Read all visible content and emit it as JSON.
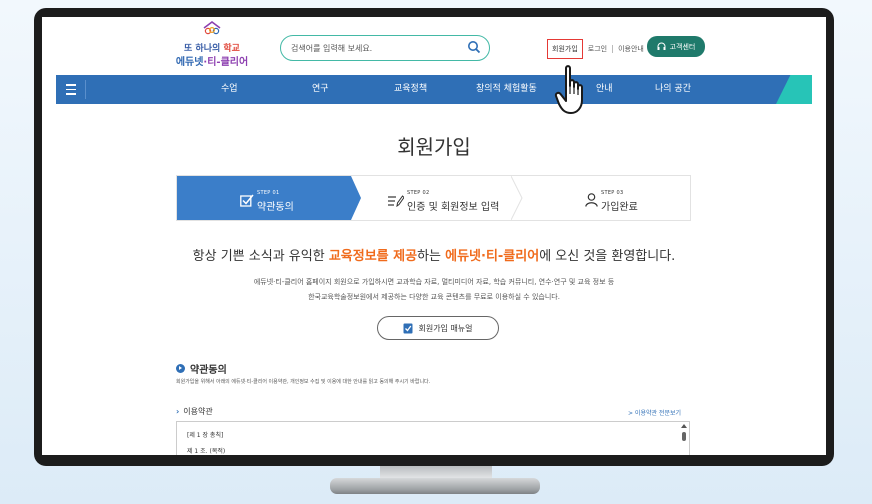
{
  "logo": {
    "line1_a": "또 하나의 ",
    "line1_b": "학교",
    "line2_a": "에듀넷",
    "line2_b": "·티-클리어"
  },
  "search": {
    "placeholder": "검색어를 입력해 보세요."
  },
  "top_links": [
    {
      "label": "회원가입",
      "highlighted": true
    },
    {
      "label": "로그인"
    },
    {
      "label": "이용안내"
    }
  ],
  "customer_center": {
    "label": "고객센터"
  },
  "gnb": {
    "items": [
      "수업",
      "연구",
      "교육정책",
      "창의적 체험활동",
      "안내",
      "나의 공간"
    ]
  },
  "page_title": "회원가입",
  "steps": [
    {
      "step_no": "STEP 01",
      "label": "약관동의",
      "active": true
    },
    {
      "step_no": "STEP 02",
      "label": "인증 및 회원정보 입력",
      "active": false
    },
    {
      "step_no": "STEP 03",
      "label": "가입완료",
      "active": false
    }
  ],
  "welcome": {
    "pre": "항상 기쁜 소식과 유익한 ",
    "highlight1": "교육정보를 제공",
    "mid": "하는 ",
    "highlight2": "에듀넷·티-클리어",
    "post": "에 오신 것을 환영합니다."
  },
  "desc": {
    "line1": "에듀넷·티-클리어 홈페이지 회원으로 가입하시면 교과학습 자료, 멀티미디어 자료, 학습 커뮤니티, 연수·연구 및 교육 정보 등",
    "line2": "한국교육학술정보원에서 제공하는 다양한 교육 콘텐츠를 무료로 이용하실 수 있습니다."
  },
  "manual_button": {
    "label": "회원가입 매뉴얼"
  },
  "agreement": {
    "title": "약관동의",
    "desc": "회원가입을 위해서 아래의 에듀넷·티-클리어 이용약관, 개인정보 수집 및 이용에 대한 안내를 읽고 동의해 주시기 바랍니다.",
    "terms_title": "이용약관",
    "full_view": "> 이용약관 전문보기",
    "chapter": "[제 1 장 총칙]",
    "article": "제 1 조. (목적)"
  },
  "colors": {
    "primary": "#2f6fb6",
    "accent": "#f06b1c",
    "cs_green": "#1f7a6b",
    "mint": "#27c4b7",
    "highlight_box": "#e53935"
  }
}
